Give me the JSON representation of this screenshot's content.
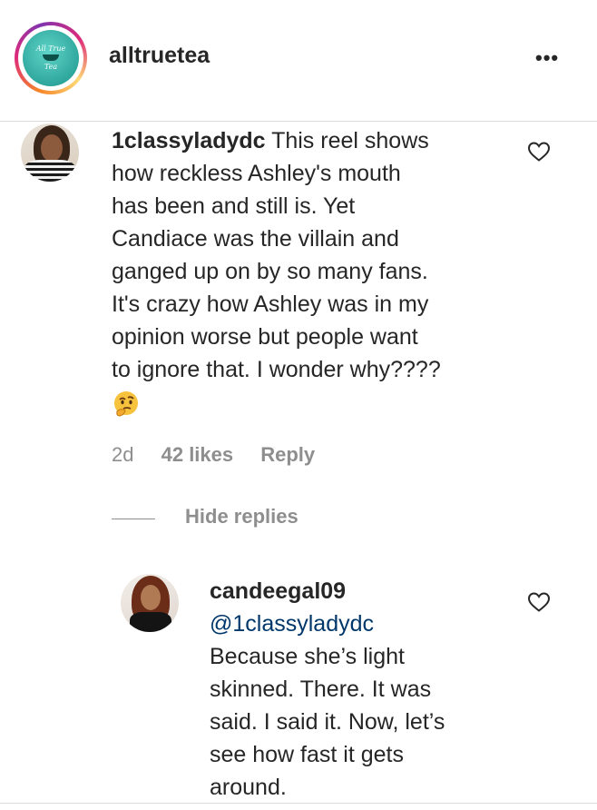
{
  "header": {
    "username": "alltruetea",
    "more_label": "•••",
    "logo_line1": "All True",
    "logo_line2": "Tea"
  },
  "comment": {
    "author": "1classyladydc",
    "lines": [
      "This reel shows",
      "how reckless Ashley's mouth",
      "has been and still is. Yet",
      "Candiace was the villain and",
      "ganged up on by so many fans.",
      "It's crazy how Ashley was in my",
      "opinion worse but people want",
      "to ignore that. I wonder why????"
    ],
    "emoji": "thinking-face",
    "time": "2d",
    "likes": "42 likes",
    "reply_label": "Reply",
    "hide_replies_label": "Hide replies"
  },
  "reply": {
    "author": "candeegal09",
    "mention": "@1classyladydc",
    "lines": [
      "Because she’s light",
      "skinned. There. It was",
      "said. I said it. Now, let’s",
      "see how fast it gets",
      "around."
    ]
  },
  "colors": {
    "text": "#262626",
    "secondary": "#8e8e8e",
    "mention": "#00376b",
    "divider": "#dbdbdb",
    "logo_teal": "#2fa79d"
  }
}
